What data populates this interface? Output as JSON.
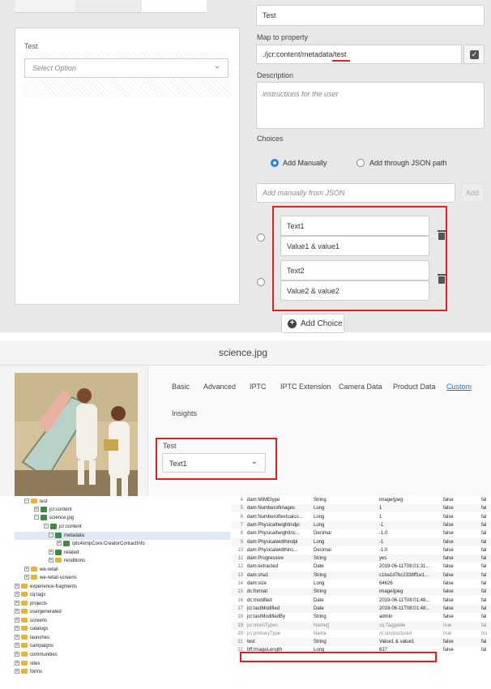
{
  "form_editor": {
    "preview": {
      "field_label": "Test",
      "select_placeholder": "Select Option"
    },
    "settings": {
      "label_value": "Test",
      "map_to_property_title": "Map to property",
      "map_to_property_value": "./jcr:content/metadata/test",
      "description_title": "Description",
      "description_placeholder": "instructions for the user",
      "choices_title": "Choices",
      "radio_add_manually": "Add Manually",
      "radio_add_json": "Add through JSON path",
      "json_placeholder": "Add manually from JSON",
      "add_button": "Add",
      "choices": [
        {
          "text": "Text1",
          "value": "Value1 & value1"
        },
        {
          "text": "Text2",
          "value": "Value2 & value2"
        }
      ],
      "add_choice_button": "Add Choice"
    },
    "accent_color": "#2680eb",
    "highlight_color": "#e0201e"
  },
  "asset_properties": {
    "title": "science.jpg",
    "tabs": [
      "Basic",
      "Advanced",
      "IPTC",
      "IPTC Extension",
      "Camera Data",
      "Product Data",
      "Custom",
      "Insights"
    ],
    "active_tab": "Custom",
    "field_label": "Test",
    "field_value": "Text1"
  },
  "crx": {
    "tree": [
      {
        "label": "test",
        "type": "folder",
        "toggle": "−"
      },
      {
        "label": "jcr:content",
        "type": "node",
        "toggle": "+"
      },
      {
        "label": "science.jpg",
        "type": "node",
        "toggle": "−"
      },
      {
        "label": "jcr:content",
        "type": "node",
        "toggle": "−"
      },
      {
        "label": "metadata",
        "type": "node",
        "toggle": "−"
      },
      {
        "label": "Iptc4xmpCore:CreatorContactInfo",
        "type": "node",
        "toggle": "+"
      },
      {
        "label": "related",
        "type": "node",
        "toggle": "+"
      },
      {
        "label": "renditions",
        "type": "folder",
        "toggle": "+"
      },
      {
        "label": "we-retail",
        "type": "folder",
        "toggle": "+"
      },
      {
        "label": "we-retail-screens",
        "type": "folder",
        "toggle": "+"
      },
      {
        "label": "experience-fragments",
        "type": "folder",
        "toggle": "+"
      },
      {
        "label": "cq:tags",
        "type": "folder",
        "toggle": "+"
      },
      {
        "label": "projects",
        "type": "folder",
        "toggle": "+"
      },
      {
        "label": "usergenerated",
        "type": "folder",
        "toggle": "+"
      },
      {
        "label": "screens",
        "type": "folder",
        "toggle": "+"
      },
      {
        "label": "catalogs",
        "type": "folder",
        "toggle": "+"
      },
      {
        "label": "launches",
        "type": "folder",
        "toggle": "+"
      },
      {
        "label": "campaigns",
        "type": "folder",
        "toggle": "+"
      },
      {
        "label": "communities",
        "type": "folder",
        "toggle": "+"
      },
      {
        "label": "sites",
        "type": "folder",
        "toggle": "+"
      },
      {
        "label": "forms",
        "type": "folder",
        "toggle": "+"
      }
    ],
    "properties": [
      {
        "no": "4",
        "name": "dam:MIMEtype",
        "type": "String",
        "value": "image/jpeg",
        "p1": "false",
        "p2": "fal"
      },
      {
        "no": "5",
        "name": "dam:Numberofimages",
        "type": "Long",
        "value": "1",
        "p1": "false",
        "p2": "fal"
      },
      {
        "no": "6",
        "name": "dam:Numberoftextualco...",
        "type": "Long",
        "value": "1",
        "p1": "false",
        "p2": "fal"
      },
      {
        "no": "7",
        "name": "dam:Physicalheightindpi",
        "type": "Long",
        "value": "-1",
        "p1": "false",
        "p2": "fal"
      },
      {
        "no": "8",
        "name": "dam:Physicalheightinc...",
        "type": "Decimal",
        "value": "-1.0",
        "p1": "false",
        "p2": "fal"
      },
      {
        "no": "9",
        "name": "dam:Physicalwidthindpi",
        "type": "Long",
        "value": "-1",
        "p1": "false",
        "p2": "fal"
      },
      {
        "no": "10",
        "name": "dam:Physicalwidthinc...",
        "type": "Decimal",
        "value": "-1.0",
        "p1": "false",
        "p2": "fal"
      },
      {
        "no": "11",
        "name": "dam:Progressive",
        "type": "String",
        "value": "yes",
        "p1": "false",
        "p2": "fal"
      },
      {
        "no": "12",
        "name": "dam:extracted",
        "type": "Date",
        "value": "2019-06-11T08:01:31...",
        "p1": "false",
        "p2": "fal"
      },
      {
        "no": "13",
        "name": "dam:sha1",
        "type": "String",
        "value": "c1ba1d7bc2338ff1e1...",
        "p1": "false",
        "p2": "fal"
      },
      {
        "no": "14",
        "name": "dam:size",
        "type": "Long",
        "value": "64626",
        "p1": "false",
        "p2": "fal"
      },
      {
        "no": "15",
        "name": "dc:format",
        "type": "String",
        "value": "image/jpeg",
        "p1": "false",
        "p2": "fal"
      },
      {
        "no": "16",
        "name": "dc:modified",
        "type": "Date",
        "value": "2019-06-11T08:01:48...",
        "p1": "false",
        "p2": "fal"
      },
      {
        "no": "17",
        "name": "jcr:lastModified",
        "type": "Date",
        "value": "2019-06-11T08:01:48...",
        "p1": "false",
        "p2": "fal"
      },
      {
        "no": "18",
        "name": "jcr:lastModifiedBy",
        "type": "String",
        "value": "admin",
        "p1": "false",
        "p2": "fal"
      },
      {
        "no": "19",
        "name": "jcr:mixinTypes",
        "type": "Name[]",
        "value": "cq:Taggable",
        "p1": "true",
        "p2": "fal"
      },
      {
        "no": "20",
        "name": "jcr:primaryType",
        "type": "Name",
        "value": "nt:unstructured",
        "p1": "true",
        "p2": "tru"
      },
      {
        "no": "21",
        "name": "test",
        "type": "String",
        "value": "Value1 & value1",
        "p1": "false",
        "p2": "fal"
      },
      {
        "no": "22",
        "name": "tiff:ImageLength",
        "type": "Long",
        "value": "637",
        "p1": "false",
        "p2": "fal"
      }
    ]
  }
}
